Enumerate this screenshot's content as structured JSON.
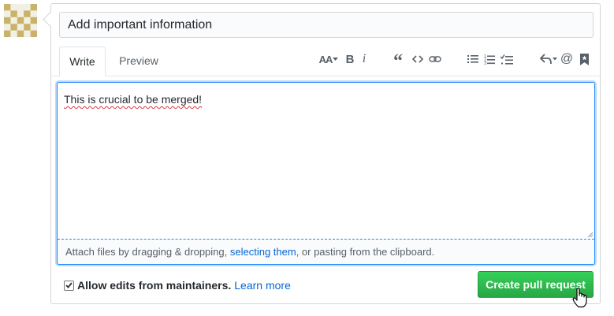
{
  "avatar": {
    "icon": "identicon-avatar",
    "color": "#c9b36b"
  },
  "title_field": {
    "value": "Add important information"
  },
  "tabs": [
    {
      "label": "Write",
      "active": true
    },
    {
      "label": "Preview",
      "active": false
    }
  ],
  "toolbar": {
    "header_icon_text": "AA",
    "bold_icon_text": "B",
    "italic_icon_text": "i",
    "quote_icon_text": "“",
    "mention_icon_text": "@",
    "icons": [
      "text-size-icon",
      "bold-icon",
      "italic-icon",
      "quote-icon",
      "code-icon",
      "link-icon",
      "bullet-list-icon",
      "numbered-list-icon",
      "task-list-icon",
      "reply-icon",
      "mention-icon",
      "bookmark-icon"
    ]
  },
  "editor": {
    "body_text": "This is crucial to be merged!",
    "attach_prefix": "Attach files by dragging & dropping, ",
    "attach_link": "selecting them",
    "attach_suffix": ", or pasting from the clipboard."
  },
  "footer": {
    "checkbox_checked": true,
    "checkbox_label": "Allow edits from maintainers.",
    "learn_more": "Learn more",
    "submit_label": "Create pull request"
  },
  "colors": {
    "accent_blue": "#0366d6",
    "focus_border": "#2188ff",
    "button_green": "#2ea44f",
    "spell_error": "#d73a49"
  }
}
